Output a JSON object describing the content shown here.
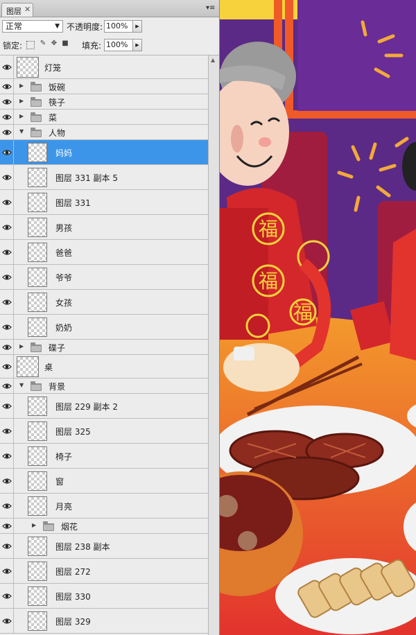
{
  "panel": {
    "tab_label": "图层",
    "tab_close": "✕",
    "menu_glyph": "▾≡",
    "blend_mode": "正常",
    "opacity_label": "不透明度:",
    "opacity_value": "100%",
    "lock_label": "锁定:",
    "fill_label": "填充:",
    "fill_value": "100%"
  },
  "layers": [
    {
      "name": "灯笼",
      "kind": "layer",
      "indent": 0,
      "big": true
    },
    {
      "name": "饭碗",
      "kind": "group",
      "indent": 0,
      "open": false
    },
    {
      "name": "筷子",
      "kind": "group",
      "indent": 0,
      "open": false
    },
    {
      "name": "菜",
      "kind": "group",
      "indent": 0,
      "open": false
    },
    {
      "name": "人物",
      "kind": "group",
      "indent": 0,
      "open": true
    },
    {
      "name": "妈妈",
      "kind": "layer",
      "indent": 1,
      "selected": true
    },
    {
      "name": "图层 331 副本 5",
      "kind": "layer",
      "indent": 1
    },
    {
      "name": "图层 331",
      "kind": "layer",
      "indent": 1
    },
    {
      "name": "男孩",
      "kind": "layer",
      "indent": 1
    },
    {
      "name": "爸爸",
      "kind": "layer",
      "indent": 1
    },
    {
      "name": "爷爷",
      "kind": "layer",
      "indent": 1
    },
    {
      "name": "女孩",
      "kind": "layer",
      "indent": 1
    },
    {
      "name": "奶奶",
      "kind": "layer",
      "indent": 1
    },
    {
      "name": "碟子",
      "kind": "group",
      "indent": 0,
      "open": false
    },
    {
      "name": "桌",
      "kind": "layer",
      "indent": 0,
      "big": true
    },
    {
      "name": "背景",
      "kind": "group",
      "indent": 0,
      "open": true
    },
    {
      "name": "图层 229 副本 2",
      "kind": "layer",
      "indent": 1
    },
    {
      "name": "图层 325",
      "kind": "layer",
      "indent": 1
    },
    {
      "name": "椅子",
      "kind": "layer",
      "indent": 1
    },
    {
      "name": "窗",
      "kind": "layer",
      "indent": 1
    },
    {
      "name": "月亮",
      "kind": "layer",
      "indent": 1
    },
    {
      "name": "烟花",
      "kind": "group",
      "indent": 1,
      "open": false
    },
    {
      "name": "图层 238 副本",
      "kind": "layer",
      "indent": 1
    },
    {
      "name": "图层 272",
      "kind": "layer",
      "indent": 1
    },
    {
      "name": "图层 330",
      "kind": "layer",
      "indent": 1
    },
    {
      "name": "图层 329",
      "kind": "layer",
      "indent": 1
    }
  ],
  "canvas": {
    "fu_char": "福",
    "colors": {
      "purple": "#5b2a86",
      "red": "#d3272b",
      "orange": "#f05a28",
      "yellow": "#f7d23c",
      "cream": "#f6e0c0"
    }
  }
}
